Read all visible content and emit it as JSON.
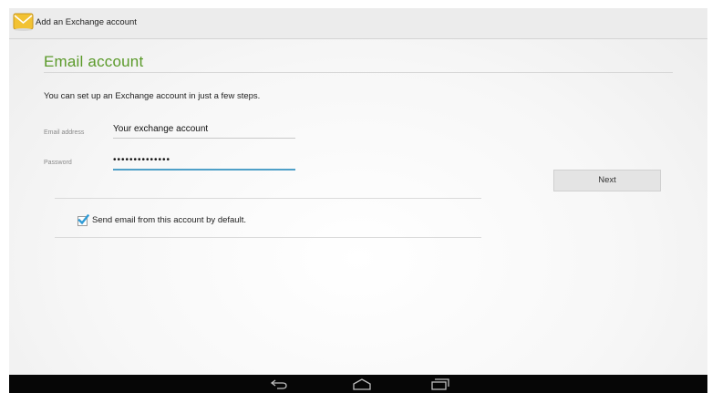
{
  "actionbar": {
    "title": "Add an Exchange account",
    "app_icon": "email-envelope-icon"
  },
  "main": {
    "heading": "Email account",
    "intro": "You can set up an Exchange account in just a few steps.",
    "email": {
      "label": "Email address",
      "value": "Your exchange account"
    },
    "password": {
      "label": "Password",
      "value": "••••••••••••••"
    },
    "next_label": "Next",
    "default_checkbox": {
      "label": "Send email from this account by default.",
      "checked": true
    }
  },
  "navbar": {
    "icons": [
      "back-icon",
      "home-icon",
      "recent-apps-icon"
    ]
  },
  "colors": {
    "heading": "#5b9a2a",
    "focus_underline": "#4fa0c8",
    "checkmark": "#2f9bd6",
    "navbar": "#060606"
  }
}
